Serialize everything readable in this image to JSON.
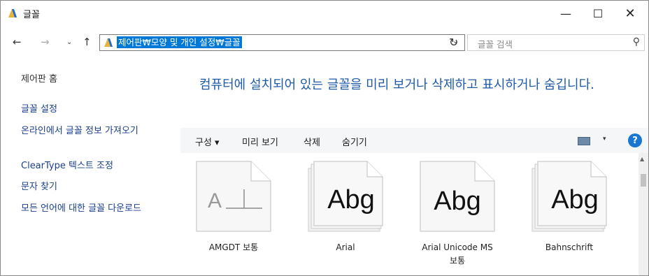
{
  "window": {
    "title": "글꼴",
    "controls": {
      "minimize": "—",
      "maximize": "☐",
      "close": "✕"
    }
  },
  "nav": {
    "back": "←",
    "forward": "→",
    "recent": "⌄",
    "up": "↑",
    "address": "제어판₩모양 및 개인 설정₩글꼴",
    "address_drop": "⌄",
    "refresh": "↻",
    "search_placeholder": "글꼴 검색",
    "search_icon": "⚲"
  },
  "sidebar": {
    "items": [
      {
        "label": "제어판 홈"
      },
      {
        "label": "글꼴 설정"
      },
      {
        "label": "온라인에서 글꼴 정보 가져오기"
      },
      {
        "label": "ClearType 텍스트 조정"
      },
      {
        "label": "문자 찾기"
      },
      {
        "label": "모든 언어에 대한 글꼴 다운로드"
      }
    ]
  },
  "main": {
    "heading": "컴퓨터에 설치되어 있는 글꼴을 미리 보거나 삭제하고 표시하거나 숨깁니다."
  },
  "toolbar": {
    "organize": "구성 ▾",
    "preview": "미리 보기",
    "delete": "삭제",
    "hide": "숨기기",
    "view_drop": "▾",
    "help": "?"
  },
  "fonts": [
    {
      "name": "AMGDT 보통",
      "sample": "A__|__",
      "stacked": false
    },
    {
      "name": "Arial",
      "sample": "Abg",
      "stacked": true
    },
    {
      "name": "Arial Unicode MS 보통",
      "sample": "Abg",
      "stacked": false
    },
    {
      "name": "Bahnschrift",
      "sample": "Abg",
      "stacked": true
    }
  ],
  "colors": {
    "heading": "#1e5aa8",
    "selection": "#0078d7",
    "help": "#1976d2",
    "folder_icon": "#e8b33a"
  }
}
